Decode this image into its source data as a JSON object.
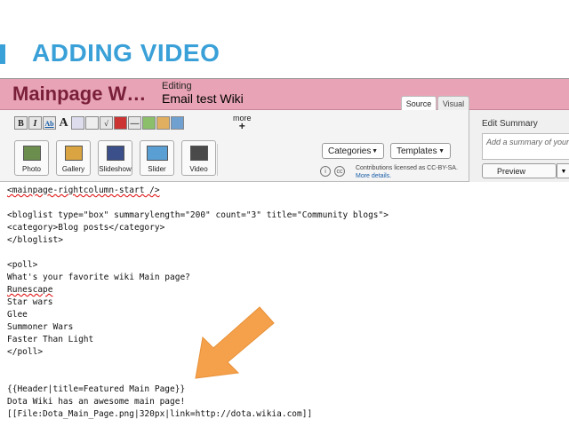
{
  "slide": {
    "title": "ADDING VIDEO"
  },
  "header": {
    "wiki_name": "Mainpage W…",
    "editing_label": "Editing",
    "page_name": "Email test Wiki",
    "tabs": [
      {
        "label": "Source"
      },
      {
        "label": "Visual"
      }
    ]
  },
  "toolbar": {
    "format_buttons": [
      "B",
      "I",
      "Ab",
      "A",
      "link",
      "sign",
      "√",
      "media",
      "—",
      "a",
      "b",
      "c"
    ],
    "more_label": "more",
    "more_plus": "+",
    "media_buttons": [
      {
        "label": "Photo",
        "icon": "photo-icon"
      },
      {
        "label": "Gallery",
        "icon": "gallery-icon"
      },
      {
        "label": "Slideshow",
        "icon": "slideshow-icon"
      },
      {
        "label": "Slider",
        "icon": "slider-icon"
      },
      {
        "label": "Video",
        "icon": "video-icon"
      }
    ],
    "categories_label": "Categories",
    "templates_label": "Templates",
    "license_line1": "Contributions licensed as CC-BY-SA.",
    "license_link": "More details."
  },
  "rail": {
    "title": "Edit Summary",
    "summary_placeholder": "Add a summary of your",
    "preview_label": "Preview"
  },
  "editor": {
    "lines": [
      "<mainpage-rightcolumn-start />",
      "",
      "<bloglist type=\"box\" summarylength=\"200\" count=\"3\" title=\"Community blogs\">",
      "<category>Blog posts</category>",
      "</bloglist>",
      "",
      "<poll>",
      "What's your favorite wiki Main page?",
      "Runescape",
      "Star wars",
      "Glee",
      "Summoner Wars",
      "Faster Than Light",
      "</poll>",
      "",
      "",
      "{{Header|title=Featured Main Page}}",
      "Dota Wiki has an awesome main page!",
      "[[File:Dota_Main_Page.png|320px|link=http://dota.wikia.com]]"
    ]
  },
  "colors": {
    "accent": "#3aa0d8",
    "header": "#e8a4b6",
    "arrow": "#f5a04a"
  }
}
